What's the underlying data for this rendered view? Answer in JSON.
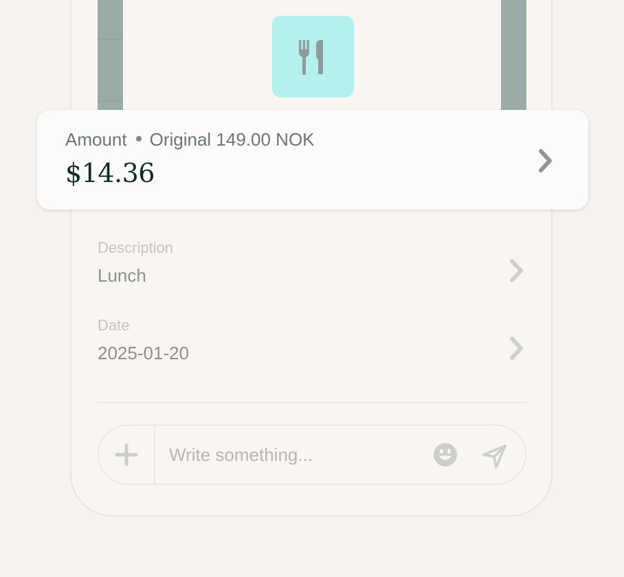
{
  "amount": {
    "label": "Amount",
    "original": "Original 149.00 NOK",
    "value": "$14.36"
  },
  "rows": [
    {
      "label": "Description",
      "value": "Lunch"
    },
    {
      "label": "Date",
      "value": "2025-01-20"
    }
  ],
  "composer": {
    "placeholder": "Write something..."
  },
  "icons": {
    "category": "cutlery-icon",
    "chevron": "chevron-right-icon",
    "add": "plus-icon",
    "emoji": "smiley-icon",
    "send": "send-icon"
  },
  "colors": {
    "tile": "#b3f0ee",
    "strip": "#9aaca5",
    "amount_text": "#0f2b24"
  }
}
